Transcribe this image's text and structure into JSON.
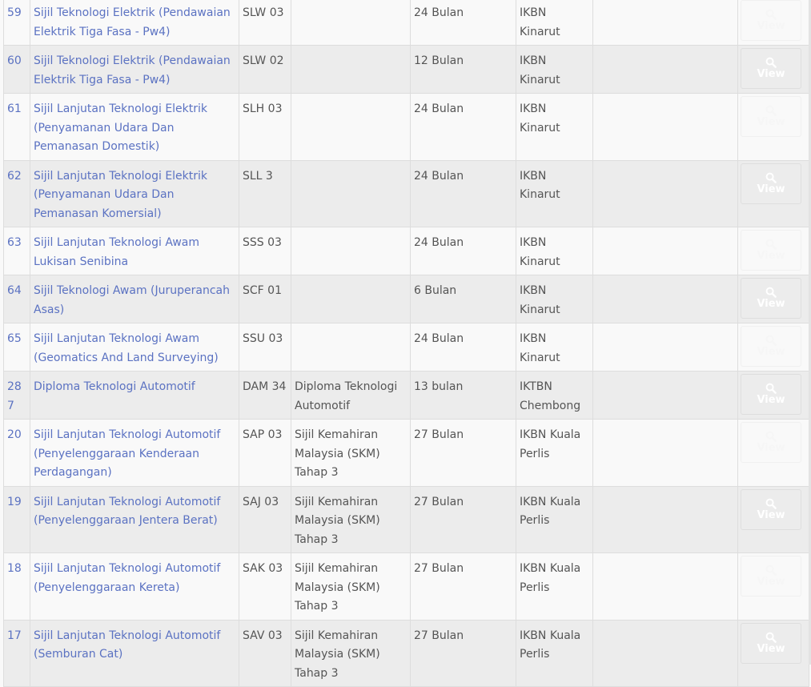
{
  "table": {
    "rows": [
      {
        "id": "59",
        "name": "Sijil Teknologi Elektrik (Pendawaian Elektrik Tiga Fasa - Pw4)",
        "code": "SLW 03",
        "qualification": "",
        "duration": "24 Bulan",
        "institution": "IKBN Kinarut",
        "notes": "",
        "button": "View"
      },
      {
        "id": "60",
        "name": "Sijil Teknologi Elektrik (Pendawaian Elektrik Tiga Fasa - Pw4)",
        "code": "SLW 02",
        "qualification": "",
        "duration": "12 Bulan",
        "institution": "IKBN Kinarut",
        "notes": "",
        "button": "View"
      },
      {
        "id": "61",
        "name": "Sijil Lanjutan Teknologi Elektrik (Penyamanan Udara Dan Pemanasan Domestik)",
        "code": "SLH 03",
        "qualification": "",
        "duration": "24 Bulan",
        "institution": "IKBN Kinarut",
        "notes": "",
        "button": "View"
      },
      {
        "id": "62",
        "name": "Sijil Lanjutan Teknologi Elektrik (Penyamanan Udara Dan Pemanasan Komersial)",
        "code": "SLL 3",
        "qualification": "",
        "duration": "24 Bulan",
        "institution": "IKBN Kinarut",
        "notes": "",
        "button": "View"
      },
      {
        "id": "63",
        "name": "Sijil Lanjutan Teknologi Awam Lukisan Senibina",
        "code": "SSS 03",
        "qualification": "",
        "duration": "24 Bulan",
        "institution": "IKBN Kinarut",
        "notes": "",
        "button": "View"
      },
      {
        "id": "64",
        "name": "Sijil Teknologi Awam (Juruperancah Asas)",
        "code": "SCF 01",
        "qualification": "",
        "duration": "6 Bulan",
        "institution": "IKBN Kinarut",
        "notes": "",
        "button": "View"
      },
      {
        "id": "65",
        "name": "Sijil Lanjutan Teknologi Awam (Geomatics And Land Surveying)",
        "code": "SSU 03",
        "qualification": "",
        "duration": "24 Bulan",
        "institution": "IKBN Kinarut",
        "notes": "",
        "button": "View"
      },
      {
        "id": "287",
        "name": "Diploma Teknologi Automotif",
        "code": "DAM 34",
        "qualification": "Diploma Teknologi Automotif",
        "duration": "13 bulan",
        "institution": "IKTBN Chembong",
        "notes": "",
        "button": "View"
      },
      {
        "id": "20",
        "name": "Sijil Lanjutan Teknologi Automotif (Penyelenggaraan Kenderaan Perdagangan)",
        "code": "SAP 03",
        "qualification": "Sijil Kemahiran Malaysia (SKM) Tahap 3",
        "duration": "27 Bulan",
        "institution": "IKBN Kuala Perlis",
        "notes": "",
        "button": "View"
      },
      {
        "id": "19",
        "name": "Sijil Lanjutan Teknologi Automotif (Penyelenggaraan Jentera Berat)",
        "code": "SAJ 03",
        "qualification": "Sijil Kemahiran Malaysia (SKM) Tahap 3",
        "duration": "27 Bulan",
        "institution": "IKBN Kuala Perlis",
        "notes": "",
        "button": "View"
      },
      {
        "id": "18",
        "name": "Sijil Lanjutan Teknologi Automotif (Penyelenggaraan Kereta)",
        "code": "SAK 03",
        "qualification": "Sijil Kemahiran Malaysia (SKM) Tahap 3",
        "duration": "27 Bulan",
        "institution": "IKBN Kuala Perlis",
        "notes": "",
        "button": "View"
      },
      {
        "id": "17",
        "name": "Sijil Lanjutan Teknologi Automotif (Semburan Cat)",
        "code": "SAV 03",
        "qualification": "Sijil Kemahiran Malaysia (SKM) Tahap 3",
        "duration": "27 Bulan",
        "institution": "IKBN Kuala Perlis",
        "notes": "",
        "button": "View"
      }
    ]
  }
}
